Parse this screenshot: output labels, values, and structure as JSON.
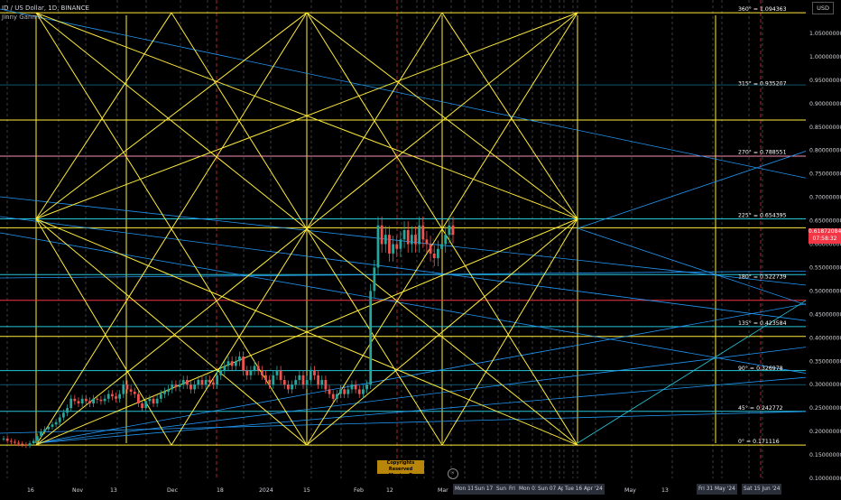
{
  "header": {
    "symbol_line": "ID / US Dollar, 1D, BINANCE",
    "indicator": "Jinny Gann R",
    "currency": "USD"
  },
  "price_tag": {
    "price": "0.61872084",
    "countdown": "07:58:32"
  },
  "watermark": {
    "line1": "Copyrights Reserved",
    "line2": "Magic_xD"
  },
  "date_tags": [
    "Mon 11",
    "Sun 17 M",
    "Sun 2",
    "Fri 2",
    "Mon 01",
    "Sun 07 Apr",
    "Tue 16 Apr '24",
    "Fri 31 May '24",
    "Sat 15 Jun '24"
  ],
  "colors": {
    "background": "#000000",
    "gann_lines": "#ffeb3b",
    "fan_lines": "#2196f3",
    "cyan_lines": "#26c6da",
    "pink_level": "#f48fb1",
    "red_level": "#f23645",
    "candle_up": "#26a69a",
    "candle_down": "#ef5350"
  },
  "chart_data": {
    "type": "candlestick",
    "title": "ID / US Dollar, 1D, BINANCE",
    "xlabel": "",
    "ylabel": "",
    "y_axis_ticks": [
      "1.05000000",
      "1.00000000",
      "0.95000000",
      "0.90000000",
      "0.85000000",
      "0.80000000",
      "0.75000000",
      "0.70000000",
      "0.65000000",
      "0.60000000",
      "0.55000000",
      "0.50000000",
      "0.45000000",
      "0.40000000",
      "0.35000000",
      "0.30000000",
      "0.25000000",
      "0.20000000",
      "0.15000000",
      "0.10000000"
    ],
    "x_axis_ticks": [
      "16",
      "Nov",
      "13",
      "Dec",
      "18",
      "2024",
      "15",
      "Feb",
      "12",
      "Mar",
      "May",
      "13"
    ],
    "ylim": [
      0.1,
      1.1
    ],
    "gann_levels": [
      {
        "angle": "360°",
        "label": "360° = 1.094363",
        "value": 1.094363
      },
      {
        "angle": "315°",
        "label": "315° = 0.935207",
        "value": 0.935207
      },
      {
        "angle": "270°",
        "label": "270° = 0.788551",
        "value": 0.788551
      },
      {
        "angle": "225°",
        "label": "225° = 0.654395",
        "value": 0.654395
      },
      {
        "angle": "180°",
        "label": "180° = 0.522739",
        "value": 0.522739
      },
      {
        "angle": "135°",
        "label": "135° = 0.423584",
        "value": 0.423584
      },
      {
        "angle": "90°",
        "label": "90° = 0.326978",
        "value": 0.326978
      },
      {
        "angle": "45°",
        "label": "45° = 0.242772",
        "value": 0.242772
      },
      {
        "angle": "0°",
        "label": "0° = 0.171116",
        "value": 0.171116
      }
    ],
    "horizontal_levels": [
      {
        "value": 1.094,
        "color": "yellow"
      },
      {
        "value": 0.865,
        "color": "yellow"
      },
      {
        "value": 0.788,
        "color": "pink"
      },
      {
        "value": 0.654,
        "color": "cyan"
      },
      {
        "value": 0.635,
        "color": "yellow"
      },
      {
        "value": 0.535,
        "color": "cyan"
      },
      {
        "value": 0.48,
        "color": "red"
      },
      {
        "value": 0.424,
        "color": "cyan"
      },
      {
        "value": 0.403,
        "color": "yellow"
      },
      {
        "value": 0.33,
        "color": "cyan"
      },
      {
        "value": 0.243,
        "color": "cyan"
      },
      {
        "value": 0.171,
        "color": "yellow"
      }
    ],
    "candles_close": [
      0.185,
      0.18,
      0.178,
      0.176,
      0.174,
      0.172,
      0.17,
      0.175,
      0.18,
      0.19,
      0.2,
      0.205,
      0.21,
      0.215,
      0.22,
      0.23,
      0.24,
      0.25,
      0.27,
      0.265,
      0.26,
      0.27,
      0.265,
      0.26,
      0.27,
      0.268,
      0.265,
      0.27,
      0.28,
      0.275,
      0.27,
      0.28,
      0.3,
      0.29,
      0.285,
      0.28,
      0.26,
      0.25,
      0.265,
      0.27,
      0.26,
      0.27,
      0.28,
      0.285,
      0.29,
      0.3,
      0.295,
      0.3,
      0.31,
      0.3,
      0.29,
      0.3,
      0.31,
      0.3,
      0.31,
      0.305,
      0.3,
      0.32,
      0.33,
      0.34,
      0.35,
      0.34,
      0.35,
      0.36,
      0.33,
      0.32,
      0.33,
      0.34,
      0.33,
      0.32,
      0.31,
      0.3,
      0.32,
      0.33,
      0.31,
      0.3,
      0.29,
      0.3,
      0.31,
      0.32,
      0.3,
      0.31,
      0.33,
      0.32,
      0.3,
      0.31,
      0.29,
      0.28,
      0.27,
      0.28,
      0.29,
      0.28,
      0.29,
      0.3,
      0.29,
      0.28,
      0.29,
      0.3,
      0.5,
      0.55,
      0.64,
      0.6,
      0.62,
      0.58,
      0.6,
      0.59,
      0.61,
      0.63,
      0.6,
      0.62,
      0.6,
      0.64,
      0.61,
      0.6,
      0.58,
      0.57,
      0.59,
      0.6,
      0.62,
      0.64,
      0.62
    ]
  }
}
